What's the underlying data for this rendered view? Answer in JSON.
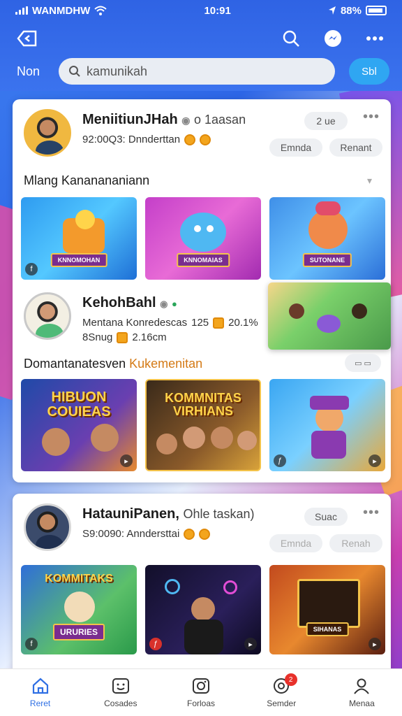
{
  "status": {
    "carrier": "WANMDHW",
    "time": "10:91",
    "battery": "88%"
  },
  "search": {
    "left_label": "Non",
    "placeholder": "kamunikah",
    "button": "Sbl"
  },
  "card1": {
    "profile1": {
      "name": "MeniitiunJHah",
      "extra": "o 1aasan",
      "sub": "92:00Q3: Dnnderttan",
      "count_pill": "2 ue",
      "actions": [
        "Emnda",
        "Renant"
      ]
    },
    "section1": {
      "title": "Mlang Kananananiann"
    },
    "row1": [
      {
        "caption": "KNNOMOHAN"
      },
      {
        "caption": "KNNOMAIAS"
      },
      {
        "caption": "SUTONANE"
      }
    ],
    "profile2": {
      "name": "KehohBahl",
      "sub1": "Mentana Konredescas",
      "num": "125",
      "pct": "20.1%",
      "sub2": "8Snug",
      "val": "2.16cm"
    },
    "section2": {
      "title": "Domantanatesven",
      "accent": "Kukemenitan"
    },
    "row2": [
      {
        "title_l1": "HIBUON",
        "title_l2": "COUIEAS"
      },
      {
        "title_l1": "KOMMNITAS",
        "title_l2": "VIRHIANS"
      },
      {
        "title_l1": "",
        "title_l2": ""
      }
    ]
  },
  "card2": {
    "profile": {
      "name": "HatauniPanen,",
      "extra": "Ohle taskan)",
      "sub": "S9:0090: Anndersttai",
      "count_pill": "Suac",
      "actions": [
        "Emnda",
        "Renah"
      ]
    },
    "row": [
      {
        "title_l1": "KOMMITAKS",
        "caption": "URURIES"
      },
      {
        "title_l1": "",
        "caption": ""
      },
      {
        "title_l1": "",
        "caption": "SIHANAS"
      }
    ]
  },
  "tabs": [
    {
      "label": "Reret",
      "icon": "home-icon"
    },
    {
      "label": "Cosades",
      "icon": "smile-icon"
    },
    {
      "label": "Forloas",
      "icon": "camera-icon"
    },
    {
      "label": "Semder",
      "icon": "notification-icon",
      "badge": "2"
    },
    {
      "label": "Menaa",
      "icon": "profile-icon"
    }
  ],
  "colors": {
    "header": "#2f63e4",
    "accent": "#2f6fe4",
    "badge": "#e8312b"
  }
}
